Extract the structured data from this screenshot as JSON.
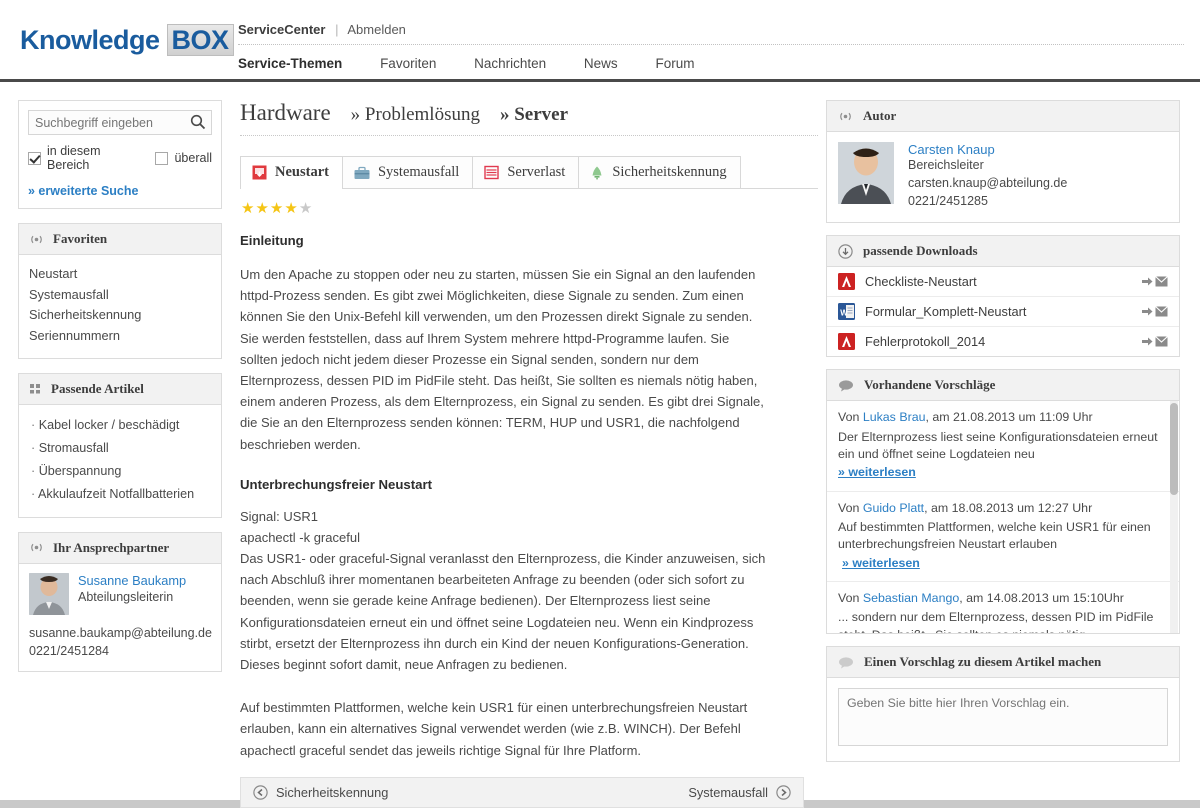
{
  "brand": {
    "name_part1": "Knowledge",
    "name_part2": "BOX"
  },
  "topnav": {
    "service_center": "ServiceCenter",
    "separator": "|",
    "logout": "Abmelden",
    "items": [
      {
        "label": "Service-Themen",
        "active": true
      },
      {
        "label": "Favoriten",
        "active": false
      },
      {
        "label": "Nachrichten",
        "active": false
      },
      {
        "label": "News",
        "active": false
      },
      {
        "label": "Forum",
        "active": false
      }
    ]
  },
  "search": {
    "placeholder": "Suchbegriff eingeben",
    "value": "",
    "scope_local": "in diesem Bereich",
    "scope_global": "überall",
    "advanced": "» erweiterte Suche",
    "icon": "search-icon"
  },
  "favorites": {
    "title": "Favoriten",
    "icon": "broadcast-icon",
    "items": [
      "Neustart",
      "Systemausfall",
      "Sicherheitskennung",
      "Seriennummern"
    ]
  },
  "related_articles": {
    "title": "Passende Artikel",
    "icon": "grid-icon",
    "items": [
      "Kabel locker / beschädigt",
      "Stromausfall",
      "Überspannung",
      "Akkulaufzeit Notfallbatterien"
    ]
  },
  "contact": {
    "title": "Ihr Ansprechpartner",
    "icon": "broadcast-icon",
    "name": "Susanne Baukamp",
    "role": "Abteilungsleiterin",
    "email": "susanne.baukamp@abteilung.de",
    "phone": "0221/2451284"
  },
  "breadcrumb": {
    "level1": "Hardware",
    "level2": "» Problemlösung",
    "level3": "» Server"
  },
  "tabs": [
    {
      "label": "Neustart",
      "icon": "restart-icon",
      "active": true
    },
    {
      "label": "Systemausfall",
      "icon": "briefcase-icon",
      "active": false
    },
    {
      "label": "Serverlast",
      "icon": "server-icon",
      "active": false
    },
    {
      "label": "Sicherheitskennung",
      "icon": "bell-icon",
      "active": false
    }
  ],
  "rating": {
    "value": 4,
    "max": 5,
    "filled_color": "#f5c515",
    "empty_color": "#c9c9c9"
  },
  "article": {
    "heading1": "Einleitung",
    "paragraph1": "Um den Apache zu stoppen oder neu zu starten, müssen Sie ein Signal an den laufenden httpd-Prozess senden. Es gibt zwei Möglichkeiten, diese Signale zu senden. Zum einen können Sie den Unix-Befehl kill verwenden, um den Prozessen direkt Signale zu senden. Sie werden feststellen, dass auf Ihrem System mehrere httpd-Programme laufen. Sie sollten jedoch nicht jedem dieser Prozesse ein Signal senden, sondern nur dem Elternprozess, dessen PID im PidFile steht. Das heißt, Sie sollten es niemals nötig haben, einem anderen Prozess, als dem Elternprozess, ein Signal zu senden. Es gibt drei Signale, die Sie an den Elternprozess senden können: TERM, HUP und USR1, die nachfolgend beschrieben werden.",
    "heading2": "Unterbrechungsfreier Neustart",
    "paragraph2": "Signal: USR1",
    "paragraph3": "apachectl -k graceful",
    "paragraph4": "Das USR1- oder graceful-Signal veranlasst den Elternprozess, die Kinder anzuweisen, sich nach Abschluß ihrer momentanen bearbeiteten Anfrage zu beenden (oder sich sofort zu beenden, wenn sie gerade keine Anfrage bedienen). Der Elternprozess liest seine Konfigurationsdateien erneut ein und öffnet seine Logdateien neu. Wenn ein Kindprozess stirbt, ersetzt der Elternprozess ihn durch ein Kind der neuen Konfigurations-Generation. Dieses beginnt sofort damit, neue Anfragen zu bedienen.",
    "paragraph5": "Auf bestimmten Plattformen, welche kein USR1 für einen unterbrechungsfreien Neustart erlauben, kann ein alternatives Signal verwendet werden (wie z.B. WINCH). Der Befehl apachectl graceful sendet das jeweils richtige Signal für Ihre Platform."
  },
  "pager": {
    "prev": "Sicherheitskennung",
    "next": "Systemausfall"
  },
  "author": {
    "title": "Autor",
    "icon": "broadcast-icon",
    "name": "Carsten Knaup",
    "role": "Bereichsleiter",
    "email": "carsten.knaup@abteilung.de",
    "phone": "0221/2451285"
  },
  "downloads": {
    "title": "passende Downloads",
    "icon": "download-icon",
    "items": [
      {
        "name": "Checkliste-Neustart",
        "type": "pdf"
      },
      {
        "name": "Formular_Komplett-Neustart",
        "type": "word"
      },
      {
        "name": "Fehlerprotokoll_2014",
        "type": "pdf"
      }
    ]
  },
  "suggestions": {
    "title": "Vorhandene Vorschläge",
    "icon": "comment-icon",
    "read_more": "» weiterlesen",
    "items": [
      {
        "prefix": "Von ",
        "author": "Lukas Brau",
        "meta": ", am 21.08.2013 um 11:09 Uhr",
        "text": "Der Elternprozess liest seine Konfigurationsdateien erneut ein und öffnet seine Logdateien neu"
      },
      {
        "prefix": "Von ",
        "author": "Guido Platt",
        "meta": ", am 18.08.2013 um 12:27 Uhr",
        "text": "Auf bestimmten Plattformen, welche kein USR1 für einen unterbrechungsfreien Neustart erlauben"
      },
      {
        "prefix": "Von ",
        "author": "Sebastian Mango",
        "meta": ", am 14.08.2013 um 15:10Uhr",
        "text": "... sondern nur dem Elternprozess, dessen PID im PidFile steht. Das heißt , Sie sollten es niemals nötig ..."
      }
    ]
  },
  "new_suggestion": {
    "title": "Einen Vorschlag zu diesem Artikel machen",
    "icon": "comment-icon",
    "placeholder": "Geben Sie bitte hier Ihren Vorschlag ein.",
    "value": ""
  },
  "colors": {
    "brand_blue": "#1a5c9e",
    "link_blue": "#2c7fc4",
    "star_yellow": "#f5c515",
    "pdf_red": "#cc2222",
    "word_blue": "#2b5797"
  }
}
